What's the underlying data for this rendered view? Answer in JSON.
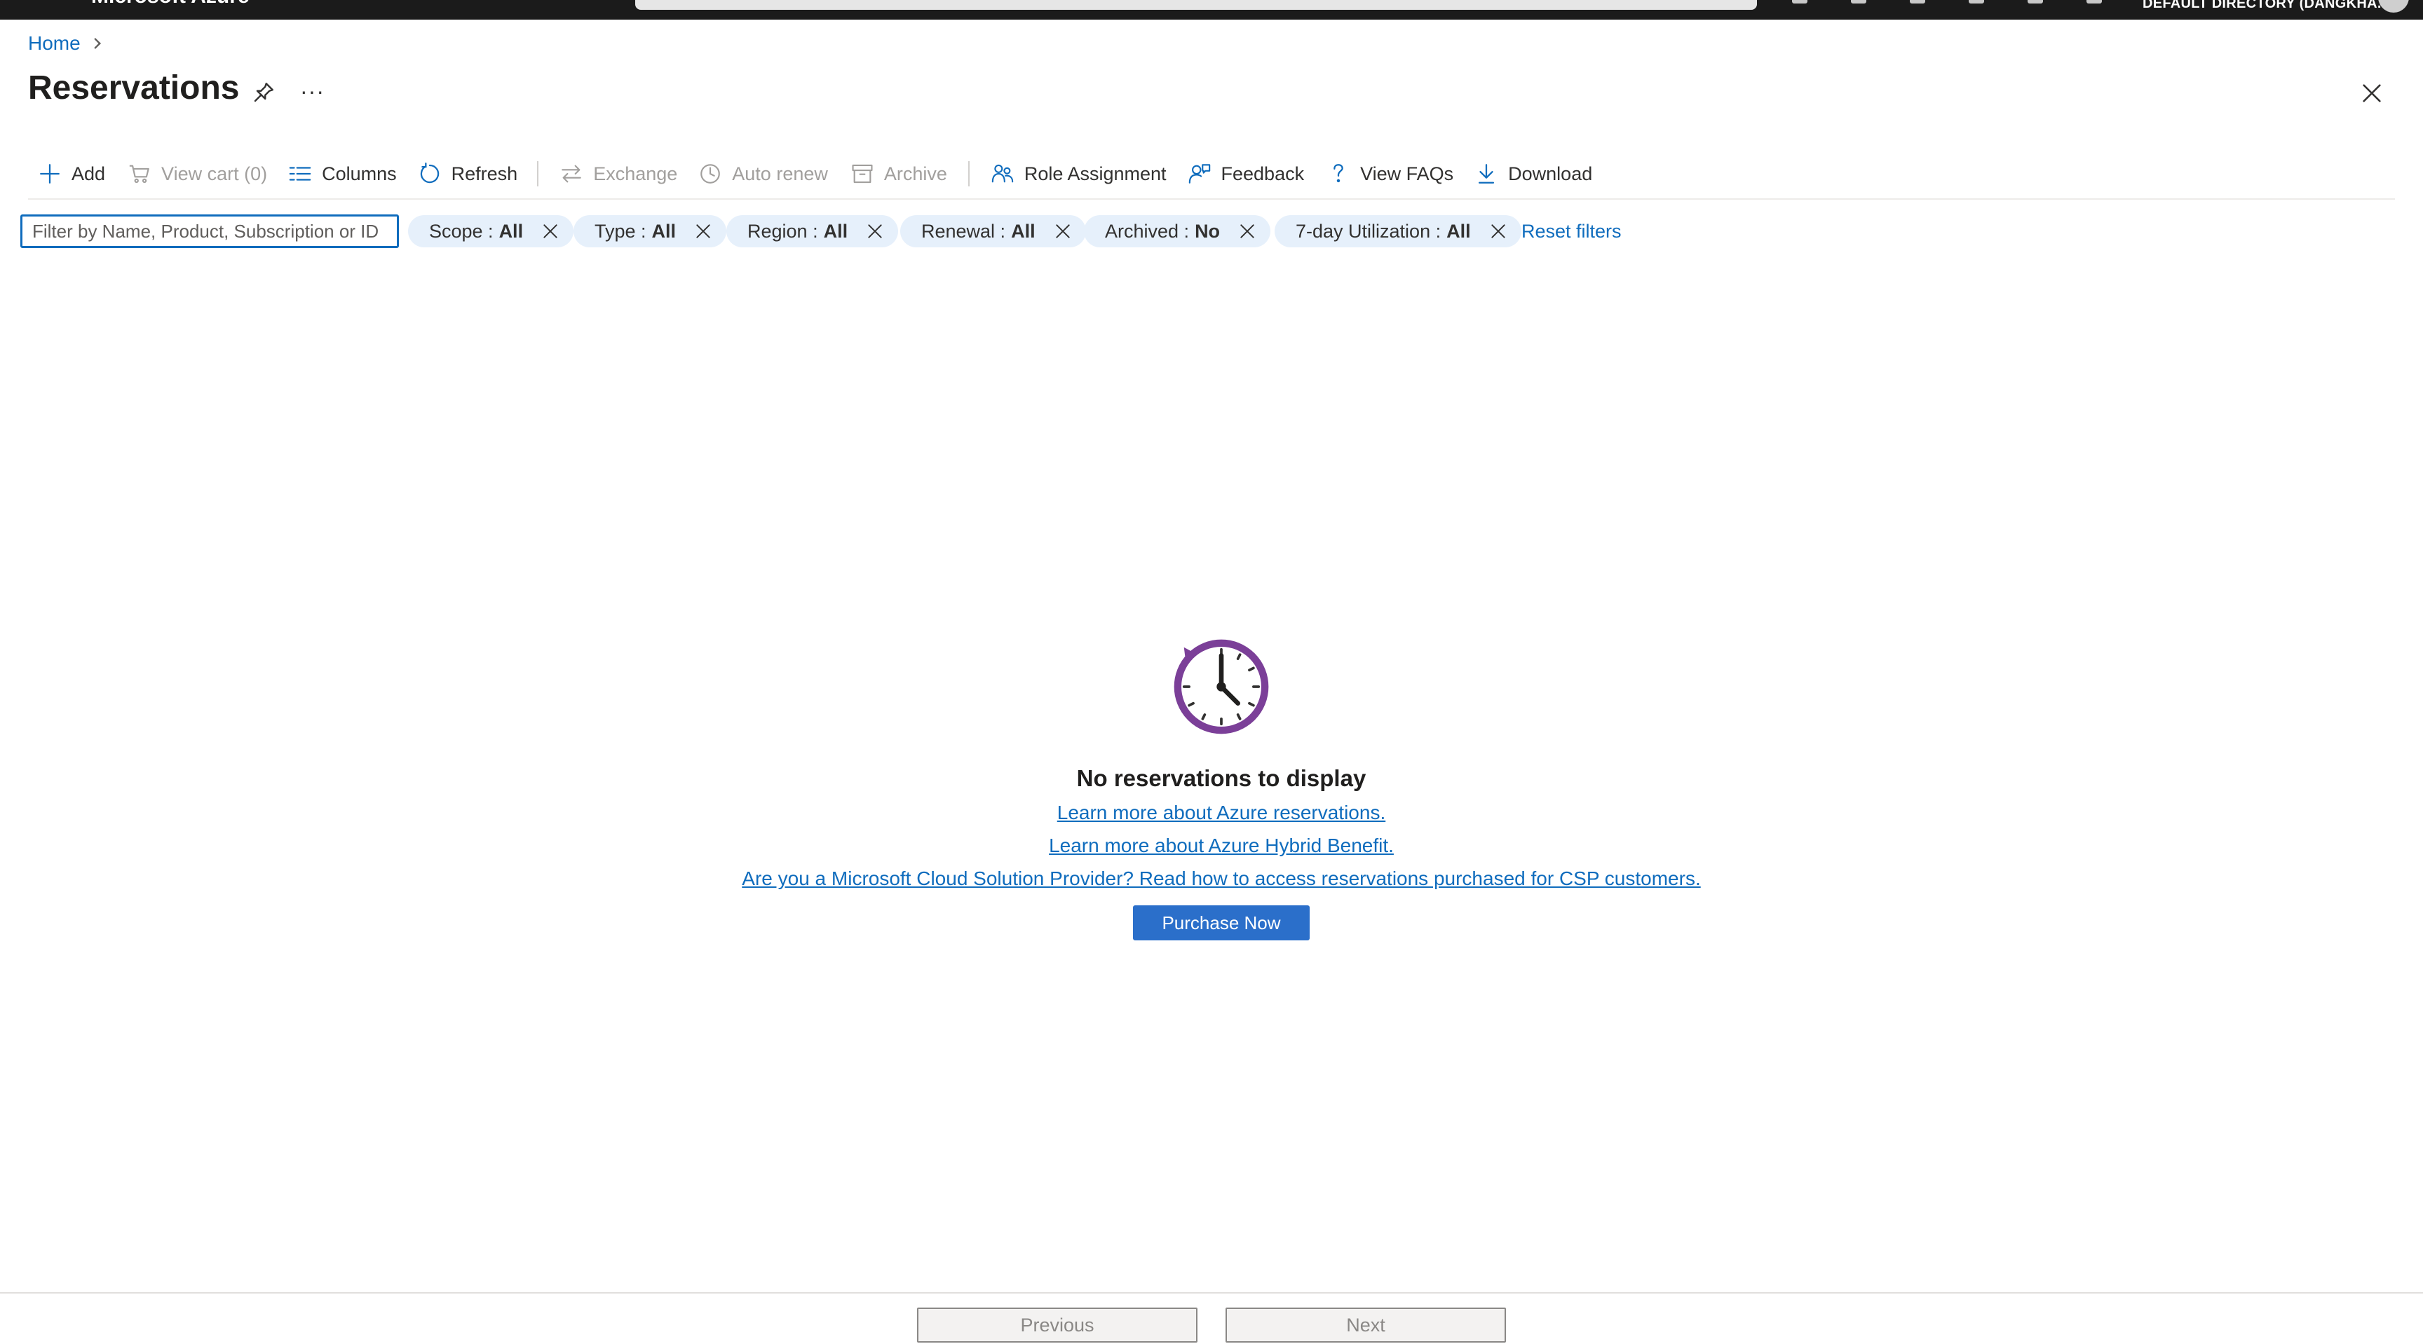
{
  "topbar": {
    "brand": "Microsoft Azure",
    "directory": "DEFAULT DIRECTORY (DANGKHA..."
  },
  "breadcrumb": {
    "home": "Home"
  },
  "page": {
    "title": "Reservations",
    "more": "···"
  },
  "commands": {
    "add": "Add",
    "view_cart": "View cart (0)",
    "columns": "Columns",
    "refresh": "Refresh",
    "exchange": "Exchange",
    "auto_renew": "Auto renew",
    "archive": "Archive",
    "role_assignment": "Role Assignment",
    "feedback": "Feedback",
    "view_faqs": "View FAQs",
    "download": "Download"
  },
  "filters": {
    "search_placeholder": "Filter by Name, Product, Subscription or ID",
    "scope": {
      "label": "Scope : ",
      "value": "All"
    },
    "type": {
      "label": "Type : ",
      "value": "All"
    },
    "region": {
      "label": "Region : ",
      "value": "All"
    },
    "renewal": {
      "label": "Renewal : ",
      "value": "All"
    },
    "archived": {
      "label": "Archived : ",
      "value": "No"
    },
    "utilization": {
      "label": "7-day Utilization : ",
      "value": "All"
    },
    "reset": "Reset filters"
  },
  "empty_state": {
    "title": "No reservations to display",
    "link_reservations": "Learn more about Azure reservations.",
    "link_hybrid": "Learn more about Azure Hybrid Benefit.",
    "link_csp": "Are you a Microsoft Cloud Solution Provider? Read how to access reservations purchased for CSP customers.",
    "purchase_button": "Purchase Now"
  },
  "pager": {
    "previous": "Previous",
    "next": "Next"
  },
  "colors": {
    "accent": "#0f6cbd",
    "button": "#2b6fca",
    "pill_bg": "#e6f0fb",
    "clock": "#7b3f98"
  }
}
